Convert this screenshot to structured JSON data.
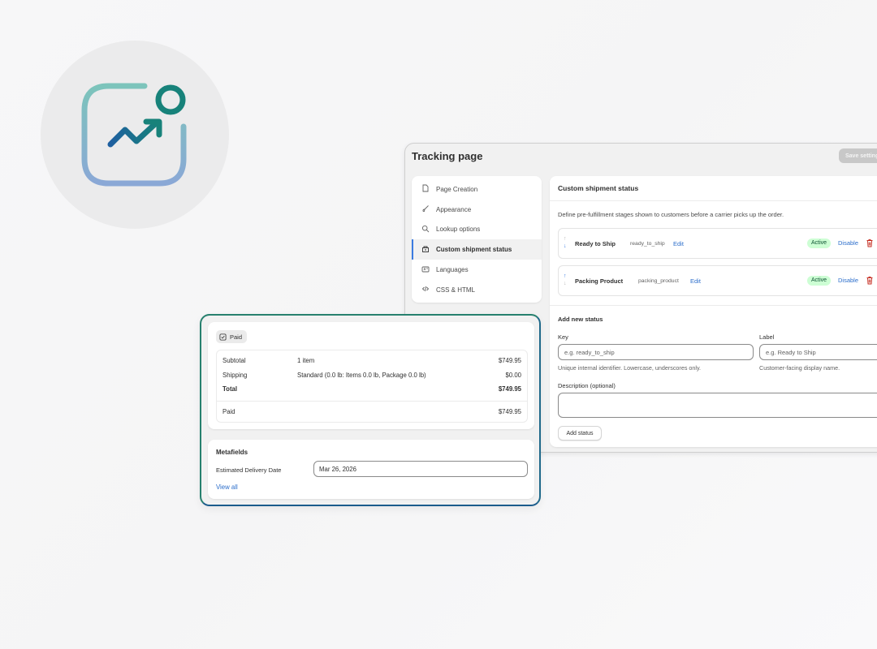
{
  "colors": {
    "accent_link": "#2c6ecb",
    "active_badge_bg": "#cdfed4",
    "active_badge_text": "#0c5132",
    "logo_teal": "#17827a",
    "logo_blue": "#1e5fa0",
    "card_border": "#27806e"
  },
  "logo": {
    "icon": "analytics-trend-icon"
  },
  "app": {
    "title": "Tracking page",
    "save_label": "Save settings",
    "nav": [
      {
        "label": "Page Creation",
        "icon": "page-icon"
      },
      {
        "label": "Appearance",
        "icon": "brush-icon"
      },
      {
        "label": "Lookup options",
        "icon": "search-icon"
      },
      {
        "label": "Custom shipment status",
        "icon": "package-icon",
        "active": true
      },
      {
        "label": "Languages",
        "icon": "language-icon"
      },
      {
        "label": "CSS & HTML",
        "icon": "code-icon"
      }
    ],
    "panel": {
      "title": "Custom shipment status",
      "description": "Define pre-fulfillment stages shown to customers before a carrier picks up the order.",
      "statuses": [
        {
          "name": "Ready to Ship",
          "key": "ready_to_ship",
          "edit": "Edit",
          "badge": "Active",
          "disable": "Disable"
        },
        {
          "name": "Packing Product",
          "key": "packing_product",
          "edit": "Edit",
          "badge": "Active",
          "disable": "Disable"
        }
      ],
      "add": {
        "title": "Add new status",
        "key_label": "Key",
        "key_placeholder": "e.g. ready_to_ship",
        "key_help": "Unique internal identifier. Lowercase, underscores only.",
        "label_label": "Label",
        "label_placeholder": "e.g. Ready to Ship",
        "label_help": "Customer-facing display name.",
        "description_label": "Description (optional)",
        "button": "Add status"
      }
    }
  },
  "order": {
    "status_chip": "Paid",
    "rows": {
      "subtotal": {
        "label": "Subtotal",
        "detail": "1 item",
        "amount": "$749.95"
      },
      "shipping": {
        "label": "Shipping",
        "detail": "Standard (0.0 lb: Items 0.0 lb, Package 0.0 lb)",
        "amount": "$0.00"
      },
      "total": {
        "label": "Total",
        "amount": "$749.95"
      },
      "paid": {
        "label": "Paid",
        "amount": "$749.95"
      }
    },
    "metafields": {
      "title": "Metafields",
      "field_label": "Estimated Delivery Date",
      "field_value": "Mar 26, 2026",
      "view_all": "View all"
    }
  }
}
